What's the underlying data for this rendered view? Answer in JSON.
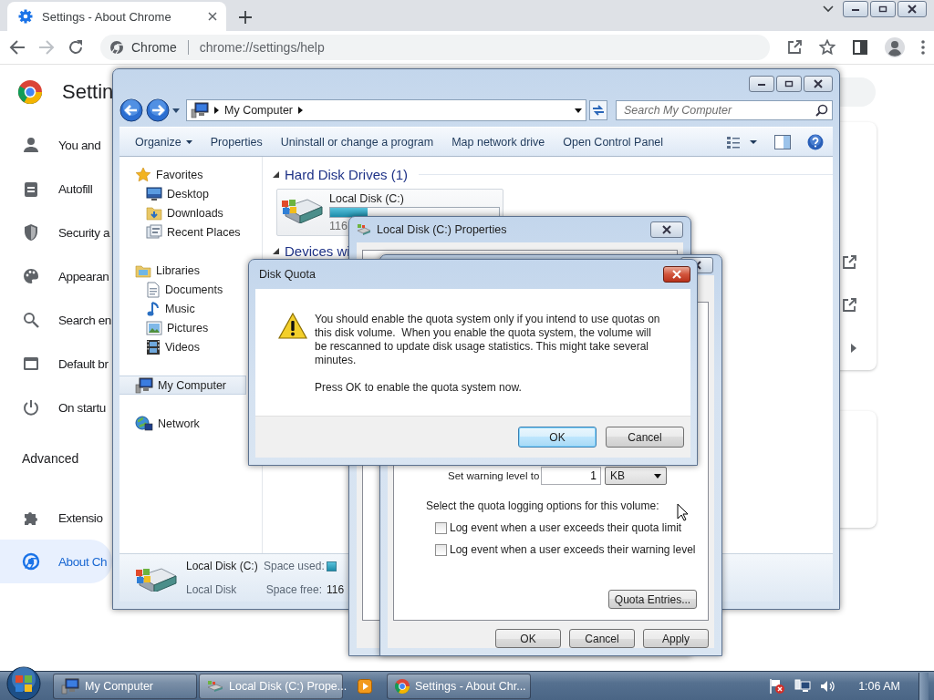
{
  "browser": {
    "tabs": [
      {
        "title": "Settings - About Chrome",
        "selected": true
      }
    ],
    "address": {
      "site": "Chrome",
      "url": "chrome://settings/help"
    },
    "settings": {
      "title": "Settin",
      "nav": [
        {
          "kind": "item",
          "label": "You and",
          "selected": false
        },
        {
          "kind": "item",
          "label": "Autofill",
          "selected": false
        },
        {
          "kind": "item",
          "label": "Security a",
          "selected": false
        },
        {
          "kind": "item",
          "label": "Appearan",
          "selected": false
        },
        {
          "kind": "item",
          "label": "Search en",
          "selected": false
        },
        {
          "kind": "item",
          "label": "Default br",
          "selected": false
        },
        {
          "kind": "item",
          "label": "On startu",
          "selected": false
        },
        {
          "kind": "heading",
          "label": "Advanced"
        },
        {
          "kind": "item",
          "label": "Extensio",
          "selected": false
        },
        {
          "kind": "item",
          "label": "About Ch",
          "selected": true
        }
      ]
    }
  },
  "explorer": {
    "breadcrumb": "My Computer",
    "search_placeholder": "Search My Computer",
    "commands": [
      "Organize",
      "Properties",
      "Uninstall or change a program",
      "Map network drive",
      "Open Control Panel"
    ],
    "nav": [
      {
        "label": "Favorites",
        "selected": false,
        "children": [
          {
            "label": "Desktop",
            "selected": false
          },
          {
            "label": "Downloads",
            "selected": false
          },
          {
            "label": "Recent Places",
            "selected": false
          }
        ]
      },
      {
        "label": "Libraries",
        "selected": false,
        "children": [
          {
            "label": "Documents",
            "selected": false
          },
          {
            "label": "Music",
            "selected": false
          },
          {
            "label": "Pictures",
            "selected": false
          },
          {
            "label": "Videos",
            "selected": false
          }
        ]
      },
      {
        "label": "My Computer",
        "selected": true
      },
      {
        "label": "Network",
        "selected": false
      }
    ],
    "groups": [
      {
        "title": "Hard Disk Drives (1)",
        "drives": [
          {
            "name": "Local Disk (C:)",
            "level": 0.22,
            "free": "116"
          }
        ]
      },
      {
        "title": "Devices wi"
      }
    ],
    "details": {
      "name": "Local Disk (C:)",
      "type": "Local Disk",
      "used_label": "Space used:",
      "free_label": "Space free:",
      "free": "116"
    }
  },
  "properties": {
    "title": "Local Disk (C:) Properties"
  },
  "quota_settings": {
    "warning_label": "Set warning level to",
    "warning_value": "1",
    "warning_unit": "KB",
    "logging_label": "Select the quota logging options for this volume:",
    "options": [
      {
        "label": "Log event when a user exceeds their quota limit",
        "checked": false
      },
      {
        "label": "Log event when a user exceeds their warning level",
        "checked": false
      }
    ],
    "entries_button": "Quota Entries...",
    "buttons": [
      "OK",
      "Cancel",
      "Apply"
    ]
  },
  "dialog": {
    "title": "Disk Quota",
    "message": "You should enable the quota system only if you intend to use quotas on this disk volume.  When you enable the quota system, the volume will be rescanned to update disk usage statistics. This might take several minutes.",
    "prompt": "Press OK to enable the quota system now.",
    "buttons": [
      {
        "label": "OK",
        "default": true
      },
      {
        "label": "Cancel",
        "default": false
      }
    ]
  },
  "taskbar": {
    "items": [
      {
        "kind": "window",
        "label": "My Computer",
        "selected": false
      },
      {
        "kind": "window",
        "label": "Local Disk (C:) Prope...",
        "selected": true
      },
      {
        "kind": "pinned",
        "selected": false
      },
      {
        "kind": "window",
        "label": "Settings - About Chr...",
        "selected": false
      }
    ],
    "clock": "1:06 AM"
  }
}
